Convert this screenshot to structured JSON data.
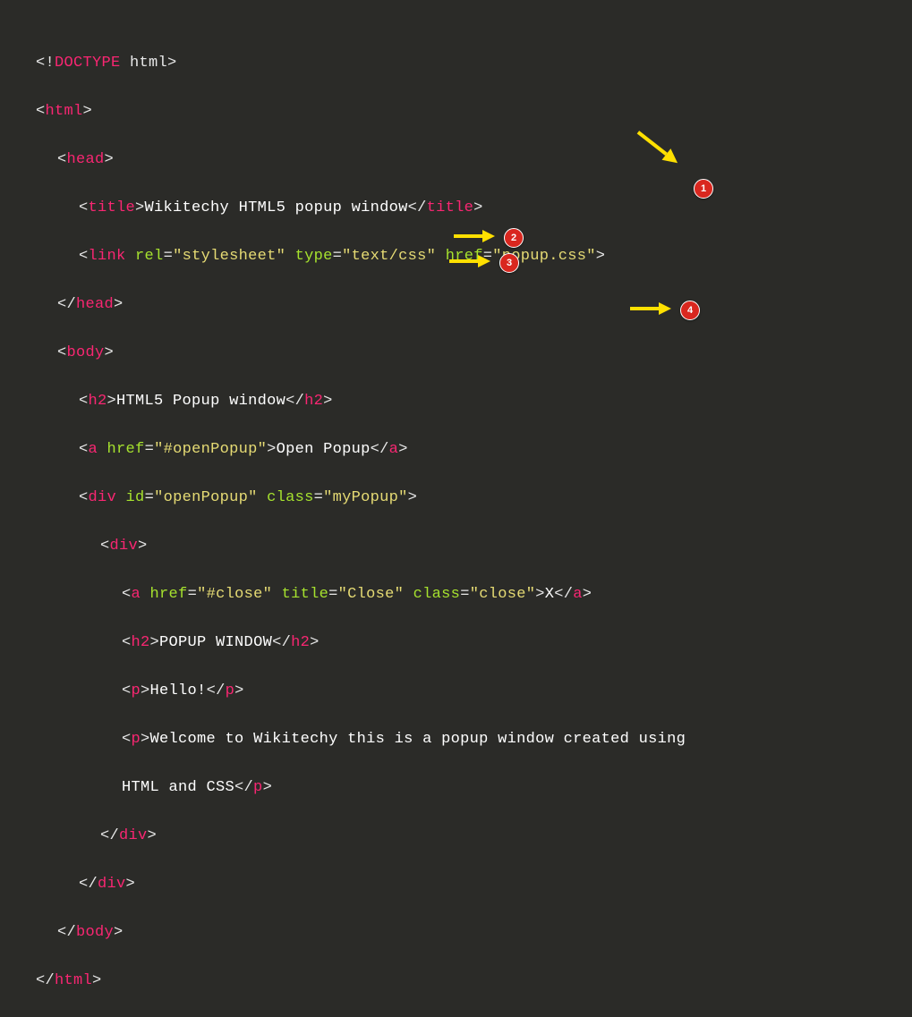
{
  "code": {
    "l0": {
      "punct1": "<!",
      "tag": "DOCTYPE",
      "rest": " html>"
    },
    "l1": {
      "open": "<",
      "tag": "html",
      "close": ">"
    },
    "l2": {
      "open": "<",
      "tag": "head",
      "close": ">"
    },
    "l3": {
      "open": "<",
      "tag": "title",
      "close": ">",
      "text": "Wikitechy HTML5 popup window",
      "copen": "</",
      "ctag": "title",
      "cclose": ">"
    },
    "l4": {
      "open": "<",
      "tag": "link",
      "sp": " ",
      "a1": "rel",
      "eq1": "=",
      "v1": "\"stylesheet\"",
      "sp2": " ",
      "a2": "type",
      "eq2": "=",
      "v2": "\"text/css\"",
      "sp3": " ",
      "a3": "href",
      "eq3": "=",
      "v3": "\"popup.css\"",
      "close": ">"
    },
    "l5": {
      "open": "</",
      "tag": "head",
      "close": ">"
    },
    "l6": {
      "open": "<",
      "tag": "body",
      "close": ">"
    },
    "l7": {
      "open": "<",
      "tag": "h2",
      "close": ">",
      "text": "HTML5 Popup window",
      "copen": "</",
      "ctag": "h2",
      "cclose": ">"
    },
    "l8": {
      "open": "<",
      "tag": "a",
      "sp": " ",
      "a1": "href",
      "eq1": "=",
      "v1": "\"#openPopup\"",
      "close": ">",
      "text": "Open Popup",
      "copen": "</",
      "ctag": "a",
      "cclose": ">"
    },
    "l9": {
      "open": "<",
      "tag": "div",
      "sp": " ",
      "a1": "id",
      "eq1": "=",
      "v1": "\"openPopup\"",
      "sp2": " ",
      "a2": "class",
      "eq2": "=",
      "v2": "\"myPopup\"",
      "close": ">"
    },
    "l10": {
      "open": "<",
      "tag": "div",
      "close": ">"
    },
    "l11": {
      "open": "<",
      "tag": "a",
      "sp": " ",
      "a1": "href",
      "eq1": "=",
      "v1": "\"#close\"",
      "sp2": " ",
      "a2": "title",
      "eq2": "=",
      "v2": "\"Close\"",
      "sp3": " ",
      "a3": "class",
      "eq3": "=",
      "v3": "\"close\"",
      "close": ">",
      "text": "X",
      "copen": "</",
      "ctag": "a",
      "cclose": ">"
    },
    "l12": {
      "open": "<",
      "tag": "h2",
      "close": ">",
      "text": "POPUP WINDOW",
      "copen": "</",
      "ctag": "h2",
      "cclose": ">"
    },
    "l13": {
      "open": "<",
      "tag": "p",
      "close": ">",
      "text": "Hello!",
      "copen": "</",
      "ctag": "p",
      "cclose": ">"
    },
    "l14": {
      "open": "<",
      "tag": "p",
      "close": ">",
      "text": "Welcome to Wikitechy this is a popup window created using",
      "cont": "HTML and CSS",
      "copen": "</",
      "ctag": "p",
      "cclose": ">"
    },
    "l15": {
      "open": "</",
      "tag": "div",
      "close": ">"
    },
    "l16": {
      "open": "</",
      "tag": "div",
      "close": ">"
    },
    "l17": {
      "open": "</",
      "tag": "body",
      "close": ">"
    },
    "l18": {
      "open": "</",
      "tag": "html",
      "close": ">"
    }
  },
  "annotations": {
    "b1": "1",
    "b2": "2",
    "b3": "3",
    "b4": "4"
  }
}
